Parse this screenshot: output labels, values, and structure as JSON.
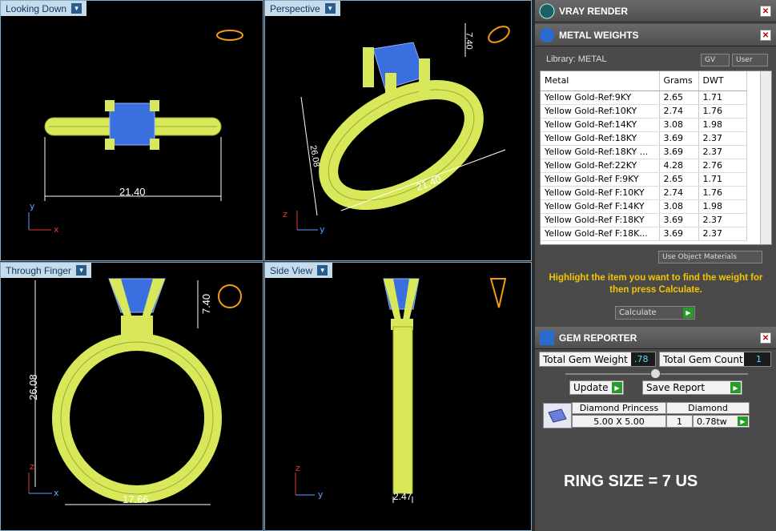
{
  "viewports": {
    "top_left": {
      "title": "Looking Down",
      "dim": "21.40"
    },
    "top_right": {
      "title": "Perspective",
      "dim_width": "21.40",
      "dim_height": "26.08",
      "dim_top": "7.40"
    },
    "bottom_left": {
      "title": "Through Finger",
      "dim_height": "26.08",
      "dim_head": "7.40",
      "dim_width": "17.66"
    },
    "bottom_right": {
      "title": "Side View",
      "dim": "2.47"
    }
  },
  "axes": {
    "x": "x",
    "y": "y",
    "z": "z"
  },
  "vray": {
    "title": "VRAY RENDER"
  },
  "metal_weights": {
    "title": "METAL WEIGHTS",
    "library": "Library: METAL",
    "gv": "GV",
    "user": "User",
    "columns": [
      "Metal",
      "Grams",
      "DWT"
    ],
    "rows": [
      [
        "Yellow Gold-Ref:9KY",
        "2.65",
        "1.71"
      ],
      [
        "Yellow Gold-Ref:10KY",
        "2.74",
        "1.76"
      ],
      [
        "Yellow Gold-Ref:14KY",
        "3.08",
        "1.98"
      ],
      [
        "Yellow Gold-Ref:18KY",
        "3.69",
        "2.37"
      ],
      [
        "Yellow Gold-Ref:18KY ...",
        "3.69",
        "2.37"
      ],
      [
        "Yellow Gold-Ref:22KY",
        "4.28",
        "2.76"
      ],
      [
        "Yellow Gold-Ref F:9KY",
        "2.65",
        "1.71"
      ],
      [
        "Yellow Gold-Ref F:10KY",
        "2.74",
        "1.76"
      ],
      [
        "Yellow Gold-Ref F:14KY",
        "3.08",
        "1.98"
      ],
      [
        "Yellow Gold-Ref F:18KY",
        "3.69",
        "2.37"
      ],
      [
        "Yellow Gold-Ref F:18K...",
        "3.69",
        "2.37"
      ]
    ],
    "use_object_materials": "Use Object Materials",
    "hint": "Highlight the item you want to find the weight for then press Calculate.",
    "calculate": "Calculate"
  },
  "gem_reporter": {
    "title": "GEM REPORTER",
    "total_weight_label": "Total Gem Weight",
    "total_weight": ".78",
    "total_count_label": "Total Gem Count",
    "total_count": "1",
    "update": "Update",
    "save_report": "Save Report",
    "gem_name": "Diamond Princess",
    "gem_size": "5.00 X 5.00",
    "material": "Diamond",
    "count": "1",
    "weight": "0.78tw"
  },
  "ring_size": "RING SIZE = 7 US",
  "colors": {
    "metal": "#d8e85a",
    "gem": "#3b6fe0",
    "panel": "#4a4a4a",
    "hint": "#f5c400"
  }
}
